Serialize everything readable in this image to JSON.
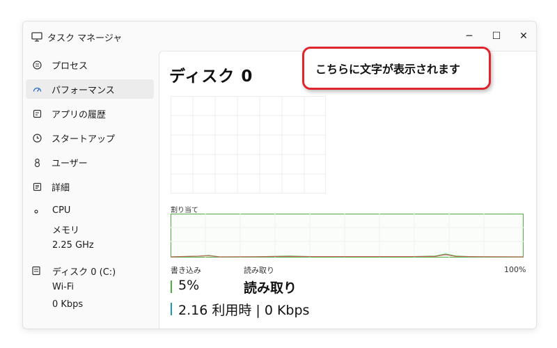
{
  "window": {
    "title": "タスク マネージャ",
    "minimize": "─",
    "maximize": "☐",
    "close": "✕"
  },
  "sidebar": {
    "items": [
      {
        "label": "プロセス",
        "icon": "processes-icon"
      },
      {
        "label": "パフォーマンス",
        "icon": "performance-icon",
        "active": true
      },
      {
        "label": "アプリの履歴",
        "icon": "app-history-icon"
      },
      {
        "label": "スタートアップ",
        "icon": "startup-icon"
      },
      {
        "label": "ユーザー",
        "icon": "users-icon"
      },
      {
        "label": "詳細",
        "icon": "details-icon"
      }
    ],
    "cpu": {
      "name": "CPU",
      "line2": "メモリ",
      "line3": "2.25 GHz"
    },
    "disk": {
      "name": "ディスク 0 (C:)",
      "line2": "Wi-Fi",
      "line3": "0 Kbps"
    }
  },
  "main": {
    "title": "ディスク 0",
    "chart_label": "割り当て",
    "write_label": "書き込み",
    "read_label": "読み取り",
    "percent_right": "100%",
    "write_value": "5%",
    "read_value": "読み取り",
    "bottom_value": "2.16 利用時 | 0 Kbps"
  },
  "callout": {
    "text": "こちらに文字が表示されます",
    "border_color": "#e0242c"
  },
  "colors": {
    "accent_green": "#4cae3c",
    "accent_teal": "#1a9bb5"
  }
}
